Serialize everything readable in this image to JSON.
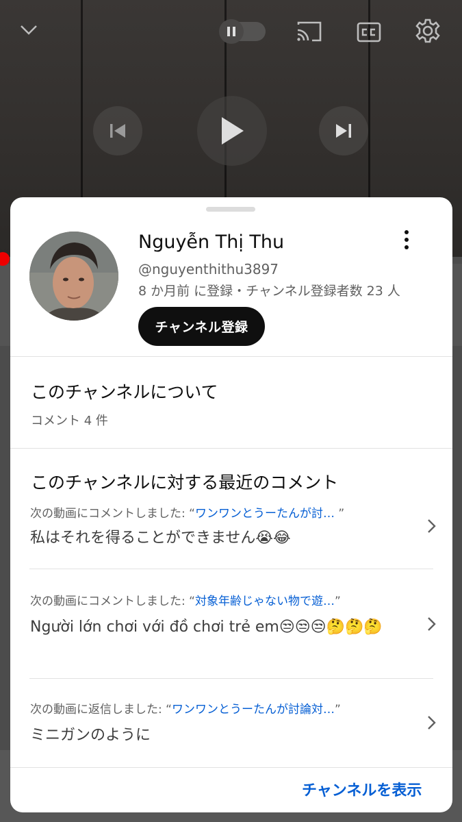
{
  "player": {
    "icons": [
      "chevron-down-icon",
      "pause-icon",
      "cast-icon",
      "cc-icon",
      "gear-icon",
      "skip-previous-icon",
      "play-icon",
      "skip-next-icon"
    ]
  },
  "channel": {
    "name": "Nguyễn Thị Thu",
    "handle": "@nguyenthithu3897",
    "meta": "8 か月前 に登録・チャンネル登録者数 23 人",
    "subscribe_label": "チャンネル登録"
  },
  "about": {
    "title": "このチャンネルについて",
    "comment_count": "コメント 4 件"
  },
  "recent": {
    "title": "このチャンネルに対する最近のコメント",
    "items": [
      {
        "context_prefix": "次の動画にコメントしました: “",
        "video_title": "ワンワンとうーたんが討…",
        "context_suffix": " ”",
        "text": "私はそれを得ることができません😭😂"
      },
      {
        "context_prefix": "次の動画にコメントしました: “",
        "video_title": "対象年齢じゃない物で遊…",
        "context_suffix": "”",
        "text": "Người lớn chơi với đồ chơi trẻ em😒😒😒🤔🤔🤔"
      },
      {
        "context_prefix": "次の動画に返信しました: “",
        "video_title": "ワンワンとうーたんが討論対…",
        "context_suffix": "”",
        "text": "ミニガンのように"
      }
    ]
  },
  "footer": {
    "view_channel_label": "チャンネルを表示"
  },
  "colors": {
    "link": "#065fd4",
    "subscribe_bg": "#0f0f0f"
  }
}
